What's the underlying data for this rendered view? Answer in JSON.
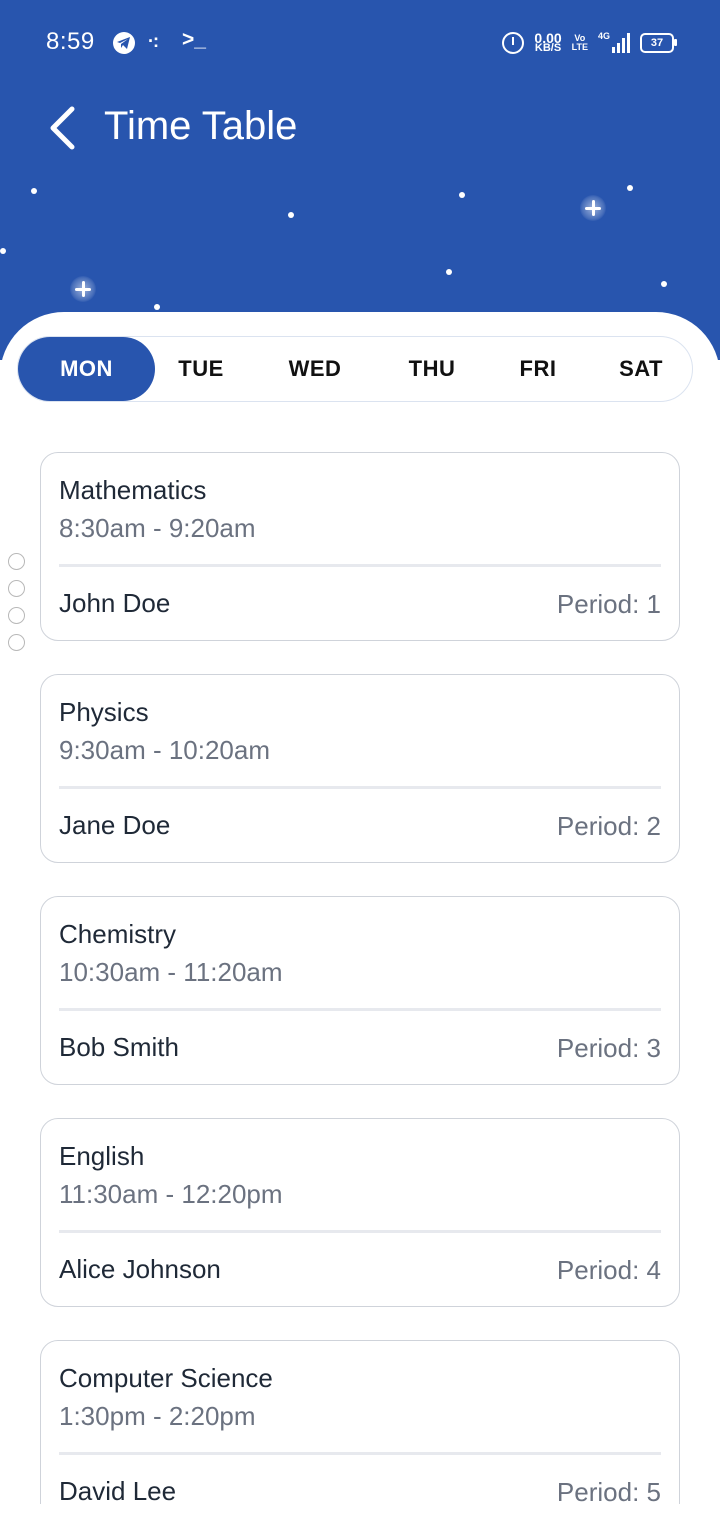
{
  "status_bar": {
    "time": "8:59",
    "dots": "·:",
    "terminal": ">_",
    "speed_value": "0.00",
    "speed_unit": "KB/S",
    "volte_top": "Vo",
    "volte_bottom": "LTE",
    "network": "4G",
    "battery": "37"
  },
  "header": {
    "title": "Time Table",
    "accent_color": "#2855ae"
  },
  "days": {
    "mon": "MON",
    "tue": "TUE",
    "wed": "WED",
    "thu": "THU",
    "fri": "FRI",
    "sat": "SAT",
    "selected": "MON"
  },
  "schedule": [
    {
      "subject": "Mathematics",
      "time": "8:30am - 9:20am",
      "teacher": "John Doe",
      "period": "Period: 1"
    },
    {
      "subject": "Physics",
      "time": "9:30am - 10:20am",
      "teacher": "Jane Doe",
      "period": "Period: 2"
    },
    {
      "subject": "Chemistry",
      "time": "10:30am - 11:20am",
      "teacher": "Bob Smith",
      "period": "Period: 3"
    },
    {
      "subject": "English",
      "time": "11:30am - 12:20pm",
      "teacher": "Alice Johnson",
      "period": "Period: 4"
    },
    {
      "subject": "Computer Science",
      "time": "1:30pm - 2:20pm",
      "teacher": "David Lee",
      "period": "Period: 5"
    }
  ]
}
